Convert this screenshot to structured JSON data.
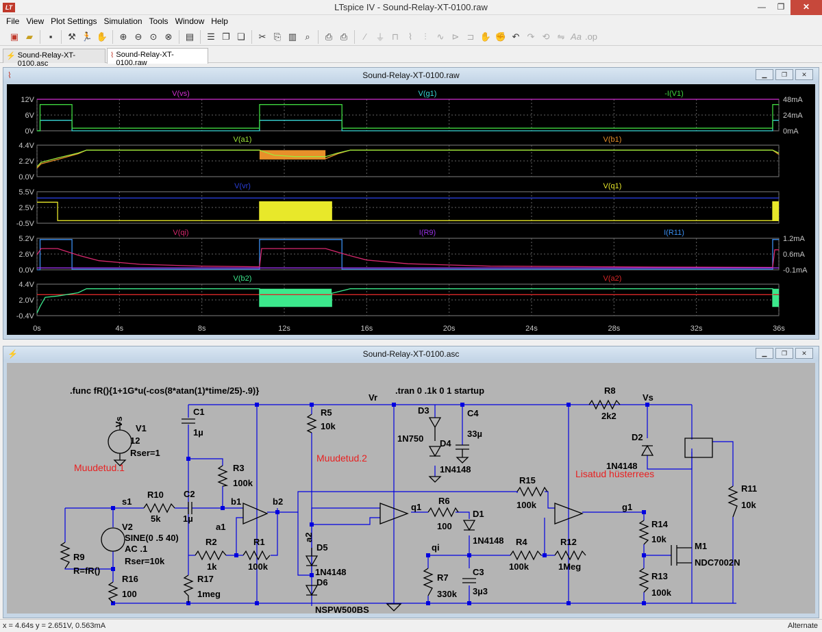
{
  "app": {
    "title": "LTspice IV - Sound-Relay-XT-0100.raw",
    "logo": "LT"
  },
  "window_buttons": {
    "minimize": "—",
    "maximize": "❐",
    "close": "✕"
  },
  "menu": [
    "File",
    "View",
    "Plot Settings",
    "Simulation",
    "Tools",
    "Window",
    "Help"
  ],
  "toolbar": {
    "icons": [
      "new-schematic-icon",
      "open-icon",
      "save-icon",
      "control-panel-icon",
      "run-icon",
      "halt-icon",
      "zoom-in-icon",
      "zoom-out-icon",
      "zoom-fit-icon",
      "zoom-cancel-icon",
      "autorange-icon",
      "tile-horizontal-icon",
      "tile-vertical-icon",
      "cascade-icon",
      "cut-icon",
      "copy-icon",
      "paste-icon",
      "find-icon",
      "print-setup-icon",
      "print-icon",
      "wire-icon",
      "ground-icon",
      "label-icon",
      "resistor-icon",
      "capacitor-icon",
      "inductor-icon",
      "diode-icon",
      "component-icon",
      "move-icon",
      "drag-icon",
      "undo-icon",
      "redo-icon",
      "rotate-icon",
      "mirror-icon",
      "text-icon",
      "spice-directive-icon"
    ]
  },
  "tabs": [
    {
      "label": "Sound-Relay-XT-0100.asc",
      "icon": "schematic-icon"
    },
    {
      "label": "Sound-Relay-XT-0100.raw",
      "icon": "waveform-icon",
      "active": true
    }
  ],
  "plot_window": {
    "title": "Sound-Relay-XT-0100.raw"
  },
  "schematic_window": {
    "title": "Sound-Relay-XT-0100.asc"
  },
  "chart_data": {
    "type": "line",
    "x_axis": {
      "range": [
        0,
        36
      ],
      "ticks": [
        "0s",
        "4s",
        "8s",
        "12s",
        "16s",
        "20s",
        "24s",
        "28s",
        "32s",
        "36s"
      ],
      "grid": true
    },
    "panes": [
      {
        "traces": [
          {
            "name": "V(vs)",
            "color": "#d22ed2"
          },
          {
            "name": "V(g1)",
            "color": "#38d8d8"
          },
          {
            "name": "-I(V1)",
            "color": "#3fd83f"
          }
        ],
        "left_ticks": [
          "12V",
          "6V",
          "0V"
        ],
        "right_ticks": [
          "48mA",
          "24mA",
          "0mA"
        ],
        "ylim": [
          0,
          12
        ],
        "series": [
          {
            "name": "V(vs)",
            "color": "#d22ed2",
            "points": [
              [
                0,
                12
              ],
              [
                36,
                12
              ]
            ]
          },
          {
            "name": "V(g1)",
            "color": "#38d8d8",
            "points": [
              [
                0,
                0
              ],
              [
                0.15,
                0
              ],
              [
                0.15,
                4
              ],
              [
                1.7,
                4
              ],
              [
                1.7,
                0
              ],
              [
                10.8,
                0
              ],
              [
                10.8,
                4
              ],
              [
                14.8,
                4
              ],
              [
                14.8,
                0
              ],
              [
                35.7,
                0
              ],
              [
                35.7,
                4
              ],
              [
                36,
                4
              ]
            ]
          },
          {
            "name": "-I(V1)",
            "color": "#3fd83f",
            "points": [
              [
                0,
                0
              ],
              [
                0.15,
                0
              ],
              [
                0.15,
                10
              ],
              [
                1.7,
                10
              ],
              [
                1.7,
                1
              ],
              [
                10.8,
                1
              ],
              [
                10.8,
                10
              ],
              [
                14.8,
                10
              ],
              [
                14.8,
                1
              ],
              [
                35.7,
                1
              ],
              [
                35.7,
                10
              ],
              [
                36,
                10
              ]
            ]
          }
        ]
      },
      {
        "traces": [
          {
            "name": "V(a1)",
            "color": "#9ee83a"
          },
          {
            "name": "V(b1)",
            "color": "#e8902a"
          }
        ],
        "left_ticks": [
          "4.4V",
          "2.2V",
          "0.0V"
        ],
        "right_ticks": [],
        "ylim": [
          0,
          4.4
        ],
        "series": [
          {
            "name": "V(b1)",
            "color": "#e8902a",
            "points": [
              [
                0,
                1.2
              ],
              [
                0.2,
                1.8
              ],
              [
                1,
                2.4
              ],
              [
                2,
                3.2
              ],
              [
                2.4,
                3.7
              ],
              [
                10.8,
                3.7
              ],
              [
                11.5,
                2.8
              ],
              [
                12.5,
                2.5
              ],
              [
                14.0,
                2.5
              ],
              [
                14.6,
                3.2
              ],
              [
                15.2,
                3.7
              ],
              [
                35.7,
                3.7
              ],
              [
                36,
                3.1
              ]
            ]
          },
          {
            "name": "V(a1)",
            "color": "#9ee83a",
            "points": [
              [
                0,
                1.4
              ],
              [
                0.2,
                2.0
              ],
              [
                1,
                2.6
              ],
              [
                2,
                3.3
              ],
              [
                2.4,
                3.7
              ],
              [
                10.8,
                3.7
              ],
              [
                11.5,
                3.0
              ],
              [
                12.5,
                2.8
              ],
              [
                14.0,
                2.8
              ],
              [
                14.6,
                3.3
              ],
              [
                15.2,
                3.7
              ],
              [
                35.7,
                3.7
              ],
              [
                36,
                3.3
              ]
            ]
          }
        ]
      },
      {
        "traces": [
          {
            "name": "V(vr)",
            "color": "#2a3ed8"
          },
          {
            "name": "V(q1)",
            "color": "#e8e82a"
          }
        ],
        "left_ticks": [
          "5.5V",
          "2.5V",
          "-0.5V"
        ],
        "right_ticks": [],
        "ylim": [
          -0.5,
          5.5
        ],
        "series": [
          {
            "name": "V(vr)",
            "color": "#2a3ed8",
            "points": [
              [
                0,
                4.3
              ],
              [
                36,
                4.3
              ]
            ]
          },
          {
            "name": "V(q1)",
            "color": "#e8e82a",
            "points": [
              [
                0,
                3.5
              ],
              [
                1.0,
                3.5
              ],
              [
                1.0,
                0
              ],
              [
                10.8,
                0
              ],
              [
                10.8,
                3.6
              ],
              [
                14.3,
                3.6
              ],
              [
                14.3,
                0
              ],
              [
                35.7,
                0
              ],
              [
                35.7,
                3.6
              ],
              [
                36,
                3.6
              ]
            ]
          }
        ]
      },
      {
        "traces": [
          {
            "name": "V(qi)",
            "color": "#d8286e"
          },
          {
            "name": "I(R9)",
            "color": "#9a32e8"
          },
          {
            "name": "I(R11)",
            "color": "#3a8ef0"
          }
        ],
        "left_ticks": [
          "5.2V",
          "2.6V",
          "0.0V"
        ],
        "right_ticks": [
          "1.2mA",
          "0.6mA",
          "-0.1mA"
        ],
        "ylim": [
          0,
          5.2
        ],
        "series": [
          {
            "name": "I(R11)",
            "color": "#3a8ef0",
            "points": [
              [
                0,
                0
              ],
              [
                0.15,
                0
              ],
              [
                0.15,
                5.0
              ],
              [
                1.7,
                5.0
              ],
              [
                1.7,
                0.1
              ],
              [
                10.8,
                0.1
              ],
              [
                10.8,
                5.0
              ],
              [
                14.8,
                5.0
              ],
              [
                14.8,
                0.1
              ],
              [
                35.7,
                0.1
              ],
              [
                35.7,
                5.0
              ],
              [
                36,
                5.0
              ]
            ]
          },
          {
            "name": "V(qi)",
            "color": "#d8286e",
            "points": [
              [
                0,
                2.5
              ],
              [
                0.2,
                3.5
              ],
              [
                1.0,
                3.5
              ],
              [
                2.0,
                2.4
              ],
              [
                3,
                1.5
              ],
              [
                5,
                0.9
              ],
              [
                8,
                0.6
              ],
              [
                10.8,
                0.5
              ],
              [
                10.9,
                3.5
              ],
              [
                14.0,
                3.5
              ],
              [
                15,
                2.5
              ],
              [
                16,
                1.6
              ],
              [
                18,
                1.0
              ],
              [
                22,
                0.6
              ],
              [
                30,
                0.45
              ],
              [
                35.7,
                0.4
              ],
              [
                35.8,
                3.3
              ],
              [
                36,
                3.3
              ]
            ]
          },
          {
            "name": "I(R9)",
            "color": "#9a32e8",
            "points": [
              [
                0,
                0.3
              ],
              [
                36,
                0.3
              ]
            ]
          }
        ]
      },
      {
        "traces": [
          {
            "name": "V(b2)",
            "color": "#3ce88c"
          },
          {
            "name": "V(a2)",
            "color": "#d82828"
          }
        ],
        "left_ticks": [
          "4.4V",
          "2.0V",
          "-0.4V"
        ],
        "right_ticks": [],
        "ylim": [
          -0.4,
          4.4
        ],
        "series": [
          {
            "name": "V(a2)",
            "color": "#d82828",
            "points": [
              [
                0,
                2.8
              ],
              [
                36,
                2.8
              ]
            ]
          },
          {
            "name": "V(b2)",
            "color": "#3ce88c",
            "points": [
              [
                0,
                0
              ],
              [
                0.15,
                1.0
              ],
              [
                0.4,
                2.4
              ],
              [
                1,
                2.6
              ],
              [
                2,
                3.1
              ],
              [
                2.4,
                3.7
              ],
              [
                10.8,
                3.7
              ],
              [
                10.8,
                1.0
              ],
              [
                14.3,
                1.0
              ],
              [
                14.3,
                3.0
              ],
              [
                15.2,
                3.7
              ],
              [
                35.7,
                3.7
              ],
              [
                35.7,
                1.0
              ],
              [
                36,
                1.0
              ]
            ]
          }
        ]
      }
    ],
    "bands": [
      {
        "pane": 1,
        "x": [
          10.8,
          14.0
        ],
        "color": "#e8902a",
        "y": [
          2.4,
          3.7
        ]
      },
      {
        "pane": 2,
        "x": [
          10.8,
          14.3
        ],
        "color": "#e8e82a",
        "y": [
          -0.1,
          3.6
        ]
      },
      {
        "pane": 4,
        "x": [
          10.8,
          14.3
        ],
        "color": "#3ce88c",
        "y": [
          1.0,
          3.7
        ]
      },
      {
        "pane": 4,
        "x": [
          35.7,
          36
        ],
        "color": "#3ce88c",
        "y": [
          1.0,
          3.7
        ]
      },
      {
        "pane": 2,
        "x": [
          35.7,
          36
        ],
        "color": "#e8e82a",
        "y": [
          -0.1,
          3.6
        ]
      }
    ]
  },
  "schematic": {
    "directives": [
      ".func fR(){1+1G*u(-cos(8*atan(1)*time/25)-.9)}",
      ".tran 0 .1k 0 1 startup"
    ],
    "notes": [
      {
        "text": "Muudetud.1",
        "color": "#e82020"
      },
      {
        "text": "Muudetud.2",
        "color": "#e82020"
      },
      {
        "text": "Lisatud hüsterrees",
        "color": "#e82020"
      }
    ],
    "nets": [
      "Vr",
      "Vs",
      "s1",
      "b1",
      "b2",
      "a1",
      "a2",
      "q1",
      "qi",
      "g1",
      "Vs"
    ],
    "components": [
      {
        "ref": "V1",
        "value": "12",
        "extra": "Rser=1"
      },
      {
        "ref": "V2",
        "value": "SINE(0 .5 40)",
        "extra": "AC .1",
        "extra2": "Rser=10k"
      },
      {
        "ref": "R10",
        "value": "5k"
      },
      {
        "ref": "C2",
        "value": "1µ"
      },
      {
        "ref": "C1",
        "value": "1µ"
      },
      {
        "ref": "R3",
        "value": "100k"
      },
      {
        "ref": "R2",
        "value": "1k"
      },
      {
        "ref": "R1",
        "value": "100k"
      },
      {
        "ref": "R9",
        "value": "R=fR()"
      },
      {
        "ref": "R16",
        "value": "100"
      },
      {
        "ref": "R17",
        "value": "1meg"
      },
      {
        "ref": "R5",
        "value": "10k"
      },
      {
        "ref": "D5",
        "value": "1N4148"
      },
      {
        "ref": "D6",
        "value": "NSPW500BS"
      },
      {
        "ref": "D3",
        "value": "1N750"
      },
      {
        "ref": "D4",
        "value": "1N4148"
      },
      {
        "ref": "C4",
        "value": "33µ"
      },
      {
        "ref": "R6",
        "value": "100"
      },
      {
        "ref": "D1",
        "value": "1N4148"
      },
      {
        "ref": "R7",
        "value": "330k"
      },
      {
        "ref": "C3",
        "value": "3µ3"
      },
      {
        "ref": "R4",
        "value": "100k"
      },
      {
        "ref": "R15",
        "value": "100k"
      },
      {
        "ref": "R12",
        "value": "1Meg"
      },
      {
        "ref": "R8",
        "value": "2k2"
      },
      {
        "ref": "D2",
        "value": "1N4148"
      },
      {
        "ref": "R14",
        "value": "10k"
      },
      {
        "ref": "R13",
        "value": "100k"
      },
      {
        "ref": "M1",
        "value": "NDC7002N"
      },
      {
        "ref": "R11",
        "value": "10k"
      }
    ]
  },
  "status": {
    "cursor": "x = 4.64s   y = 2.651V, 0.563mA",
    "mode": "Alternate"
  }
}
